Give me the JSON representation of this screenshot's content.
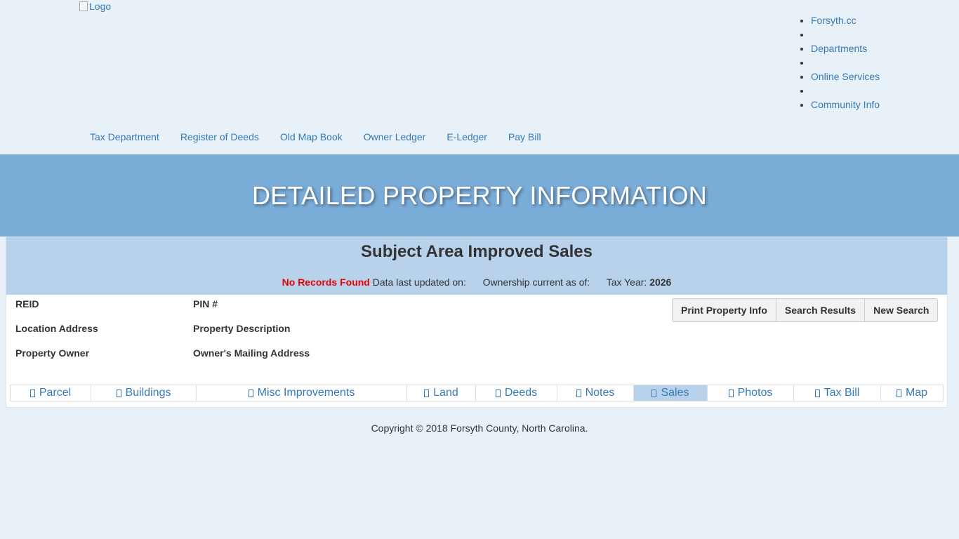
{
  "header": {
    "logo_alt": "Logo",
    "top_nav": [
      "Forsyth.cc",
      "",
      "Departments",
      "",
      "Online Services",
      "",
      "Community Info"
    ],
    "sub_nav": [
      "Tax Department",
      "Register of Deeds",
      "Old Map Book",
      "Owner Ledger",
      "E-Ledger",
      "Pay Bill"
    ]
  },
  "banner": {
    "title": "DETAILED PROPERTY INFORMATION"
  },
  "panel": {
    "title": "Subject Area Improved Sales",
    "no_records": "No Records Found",
    "data_updated_label": "Data last updated on:",
    "ownership_label": "Ownership current as of:",
    "tax_year_label": "Tax Year:",
    "tax_year_value": "2026",
    "fields": {
      "reid": "REID",
      "pin": "PIN #",
      "location_address": "Location Address",
      "property_description": "Property Description",
      "property_owner": "Property Owner",
      "owners_mailing_address": "Owner's Mailing Address"
    },
    "buttons": {
      "print": "Print Property Info",
      "search_results": "Search Results",
      "new_search": "New Search"
    },
    "tabs": [
      {
        "label": "Parcel"
      },
      {
        "label": "Buildings"
      },
      {
        "label": "Misc Improvements"
      },
      {
        "label": "Land"
      },
      {
        "label": "Deeds"
      },
      {
        "label": "Notes"
      },
      {
        "label": "Sales",
        "active": true
      },
      {
        "label": "Photos"
      },
      {
        "label": "Tax Bill"
      },
      {
        "label": "Map"
      }
    ]
  },
  "footer": {
    "copyright": "Copyright © 2018 Forsyth County, North Carolina."
  },
  "colors": {
    "page_bg": "#e8f0f8",
    "banner": "#7aacd8",
    "panel_head": "#b8d2ec",
    "link": "#337ab7",
    "no_records": "#ee0000"
  }
}
